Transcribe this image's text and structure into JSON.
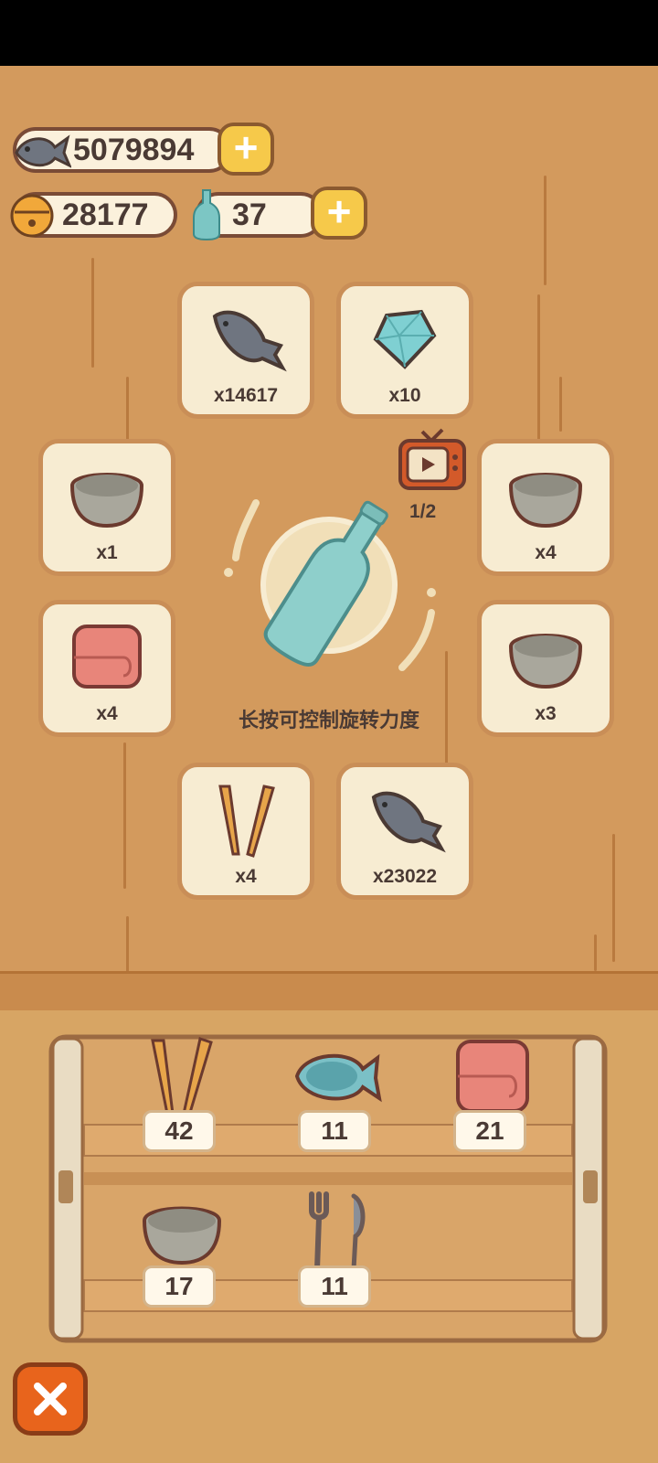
{
  "currency": {
    "fish": "5079894",
    "bells": "28177",
    "bottles": "37"
  },
  "rewards": [
    {
      "name": "fish",
      "count": "x14617"
    },
    {
      "name": "diamond",
      "count": "x10"
    },
    {
      "name": "bowl",
      "count": "x1"
    },
    {
      "name": "bowl",
      "count": "x4"
    },
    {
      "name": "towel",
      "count": "x4"
    },
    {
      "name": "bowl",
      "count": "x3"
    },
    {
      "name": "chopsticks",
      "count": "x4"
    },
    {
      "name": "fish",
      "count": "x23022"
    }
  ],
  "ad": {
    "count": "1/2"
  },
  "hint": "长按可控制旋转力度",
  "shelf": [
    {
      "item": "chopsticks",
      "count": "42"
    },
    {
      "item": "fish-plate",
      "count": "11"
    },
    {
      "item": "towel",
      "count": "21"
    },
    {
      "item": "bowl",
      "count": "17"
    },
    {
      "item": "fork-knife",
      "count": "11"
    }
  ],
  "colors": {
    "wall": "#d39a5d",
    "accent": "#f6c94a",
    "close": "#e8641c"
  }
}
